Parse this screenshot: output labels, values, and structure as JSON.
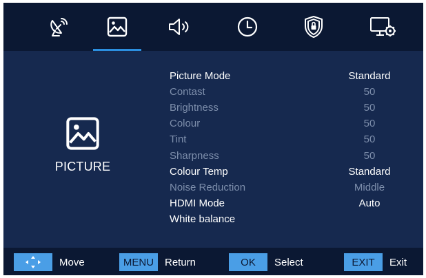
{
  "top_tabs": [
    {
      "icon": "satellite-dish-icon",
      "selected": false
    },
    {
      "icon": "picture-icon",
      "selected": true
    },
    {
      "icon": "speaker-icon",
      "selected": false
    },
    {
      "icon": "clock-icon",
      "selected": false
    },
    {
      "icon": "lock-shield-icon",
      "selected": false
    },
    {
      "icon": "monitor-settings-icon",
      "selected": false
    }
  ],
  "section": {
    "title": "PICTURE",
    "icon": "picture-icon"
  },
  "menu": [
    {
      "label": "Picture Mode",
      "value": "Standard",
      "enabled": true
    },
    {
      "label": "Contast",
      "value": "50",
      "enabled": false
    },
    {
      "label": "Brightness",
      "value": "50",
      "enabled": false
    },
    {
      "label": "Colour",
      "value": "50",
      "enabled": false
    },
    {
      "label": "Tint",
      "value": "50",
      "enabled": false
    },
    {
      "label": "Sharpness",
      "value": "50",
      "enabled": false
    },
    {
      "label": "Colour Temp",
      "value": "Standard",
      "enabled": true
    },
    {
      "label": "Noise Reduction",
      "value": "Middle",
      "enabled": false
    },
    {
      "label": "HDMI Mode",
      "value": "Auto",
      "enabled": true
    },
    {
      "label": "White balance",
      "value": "",
      "enabled": true
    }
  ],
  "footer": {
    "move": {
      "key_icon": "arrows-icon",
      "label": "Move"
    },
    "menu": {
      "key": "MENU",
      "label": "Return"
    },
    "ok": {
      "key": "OK",
      "label": "Select"
    },
    "exit": {
      "key": "EXIT",
      "label": "Exit"
    }
  },
  "colors": {
    "background": "#16294f",
    "bar": "#0b1833",
    "accent": "#2b8fe0",
    "key": "#4a9ee6",
    "text_active": "#ffffff",
    "text_dim": "#7d8eab"
  }
}
